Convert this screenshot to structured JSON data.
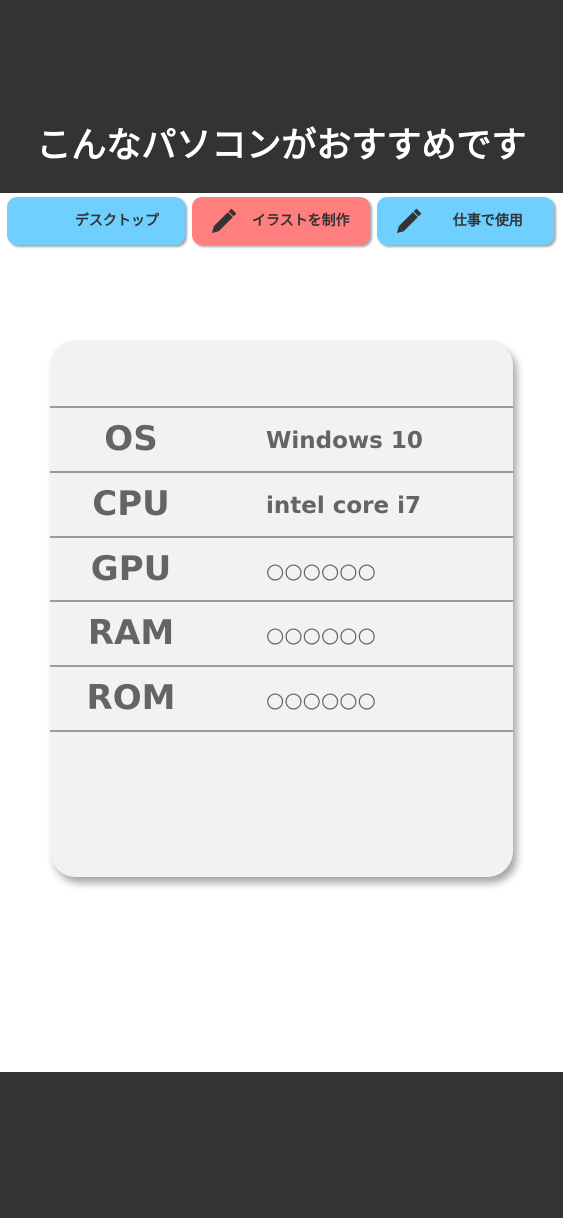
{
  "header": {
    "title": "こんなパソコンがおすすめです",
    "background": "#333333"
  },
  "tabs": [
    {
      "label": "デスクトップ",
      "icon": "none",
      "color": "#6fcfff"
    },
    {
      "label": "イラストを制作",
      "icon": "pencil-icon",
      "color": "#ff7e7e"
    },
    {
      "label": "仕事で使用",
      "icon": "pencil-icon",
      "color": "#6fcfff"
    }
  ],
  "specs": {
    "rows": [
      {
        "label": "OS",
        "value": "Windows 10"
      },
      {
        "label": "CPU",
        "value": "intel core i7"
      },
      {
        "label": "GPU",
        "value": "○○○○○○"
      },
      {
        "label": "RAM",
        "value": "○○○○○○"
      },
      {
        "label": "ROM",
        "value": "○○○○○○"
      }
    ]
  },
  "colors": {
    "accent_blue": "#6fcfff",
    "accent_red": "#ff7e7e",
    "dark": "#333333",
    "card": "#f2f2f2",
    "text_gray": "#646464"
  }
}
